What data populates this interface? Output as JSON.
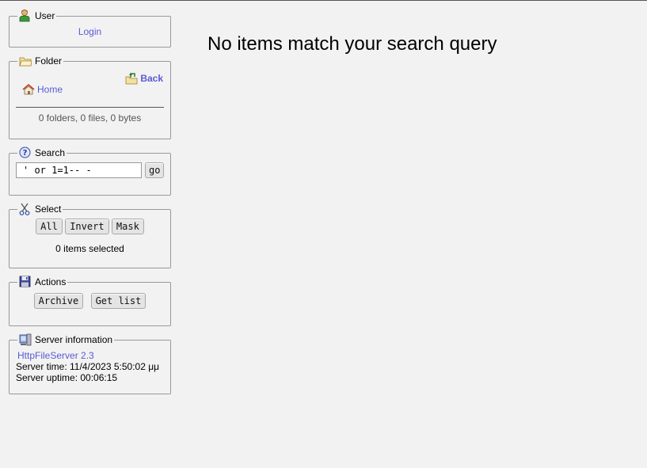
{
  "user": {
    "legend": "User",
    "login_link": "Login"
  },
  "folder": {
    "legend": "Folder",
    "back_link": "Back",
    "home_link": "Home",
    "stats": "0 folders, 0 files, 0 bytes"
  },
  "search": {
    "legend": "Search",
    "query": "' or 1=1-- -",
    "go_label": "go"
  },
  "select": {
    "legend": "Select",
    "all_label": "All",
    "invert_label": "Invert",
    "mask_label": "Mask",
    "selected_text": "0 items selected"
  },
  "actions": {
    "legend": "Actions",
    "archive_label": "Archive",
    "getlist_label": "Get list"
  },
  "server": {
    "legend": "Server information",
    "version_link": "HttpFileServer 2.3",
    "time": "Server time: 11/4/2023 5:50:02 μμ",
    "uptime": "Server uptime: 00:06:15"
  },
  "main": {
    "message": "No items match your search query"
  },
  "colors": {
    "link": "#5a5ad6",
    "background": "#f2f2f2"
  },
  "icons": [
    "user-icon",
    "folder-icon",
    "back-icon",
    "home-icon",
    "help-icon",
    "scissors-icon",
    "floppy-icon",
    "server-icon"
  ]
}
